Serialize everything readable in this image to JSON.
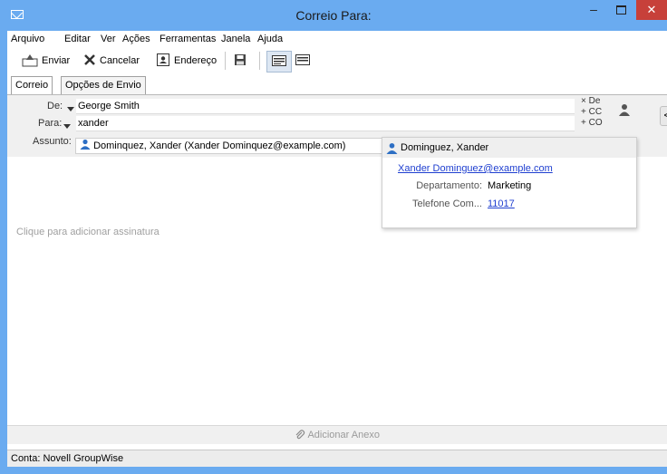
{
  "window": {
    "title": "Correio Para:",
    "minimize": "‒",
    "close": "✕"
  },
  "menu": [
    "Arquivo",
    "Editar",
    "Ver",
    "Ações",
    "Ferramentas",
    "Janela",
    "Ajuda"
  ],
  "toolbar": {
    "send_label": "Enviar",
    "cancel_label": "Cancelar",
    "address_label": "Endereço"
  },
  "tabs": [
    "Correio",
    "Opções de Envio"
  ],
  "header": {
    "from_label": "De:",
    "from_value": "George Smith",
    "to_label": "Para:",
    "to_value": "xander",
    "subject_label": "Assunto:",
    "side_links": [
      "× De",
      "+ CC",
      "+ CO"
    ]
  },
  "suggestion": {
    "text": "Dominquez, Xander (Xander Dominquez@example.com)"
  },
  "contact_card": {
    "name": "Dominguez, Xander",
    "email": "Xander Dominguez@example.com",
    "department_label": "Departamento:",
    "department_value": "Marketing",
    "phone_label": "Telefone Com...",
    "phone_value": "11017"
  },
  "body": {
    "signature_placeholder": "Clique para adicionar assinatura"
  },
  "attach": {
    "label": "Adicionar Anexo"
  },
  "status": {
    "account": "Conta: Novell GroupWise"
  },
  "colors": {
    "title_bar": "#6aabf0",
    "close_button": "#c7403a",
    "link": "#1f3fd0",
    "person_icon": "#2d6fc4"
  }
}
